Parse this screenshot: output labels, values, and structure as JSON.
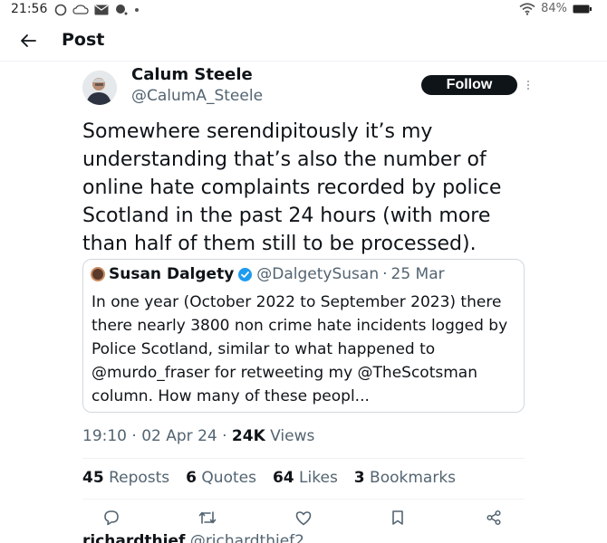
{
  "status_bar": {
    "time": "21:56",
    "battery": "84%"
  },
  "header": {
    "title": "Post",
    "back_icon": "arrow-left-icon"
  },
  "post": {
    "author_name": "Calum Steele",
    "author_handle": "@CalumA_Steele",
    "follow_label": "Follow",
    "text": "Somewhere serendipitously it’s my understanding that’s also the number of online hate complaints recorded by police Scotland in the past 24 hours (with more than half of them still to be processed).",
    "time": "19:10",
    "date": "02 Apr 24",
    "views_count": "24K",
    "views_label": "Views"
  },
  "quote": {
    "name": "Susan Dalgety",
    "handle": "@DalgetySusan",
    "date": "25 Mar",
    "text": "In one year (October 2022 to September 2023) there there nearly 3800 non crime hate incidents logged by Police Scotland, similar to what happened to @murdo_fraser for retweeting my @TheScotsman column. How many of these peopl..."
  },
  "stats": {
    "reposts_count": "45",
    "reposts_label": "Reposts",
    "quotes_count": "6",
    "quotes_label": "Quotes",
    "likes_count": "64",
    "likes_label": "Likes",
    "bookmarks_count": "3",
    "bookmarks_label": "Bookmarks"
  },
  "actions": [
    "reply-icon",
    "repost-icon",
    "like-icon",
    "bookmark-icon",
    "share-icon"
  ],
  "next_post": {
    "name": "richardthief",
    "handle": "@richardthief2"
  },
  "colors": {
    "text": "#0f1419",
    "muted": "#536471",
    "verified": "#1d9bf0",
    "border": "#cfd9de"
  }
}
